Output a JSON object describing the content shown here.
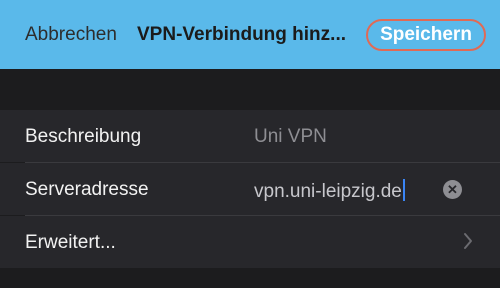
{
  "navbar": {
    "cancel_label": "Abbrechen",
    "title": "VPN-Verbindung hinz...",
    "save_label": "Speichern",
    "bar_color": "#5ab9ea",
    "save_highlight_color": "#e06a55"
  },
  "form": {
    "description": {
      "label": "Beschreibung",
      "placeholder": "Uni VPN"
    },
    "server": {
      "label": "Serveradresse",
      "value": "vpn.uni-leipzig.de",
      "clear_icon": "clear-circle-icon"
    },
    "advanced": {
      "label": "Erweitert...",
      "icon": "chevron-right-icon"
    }
  }
}
